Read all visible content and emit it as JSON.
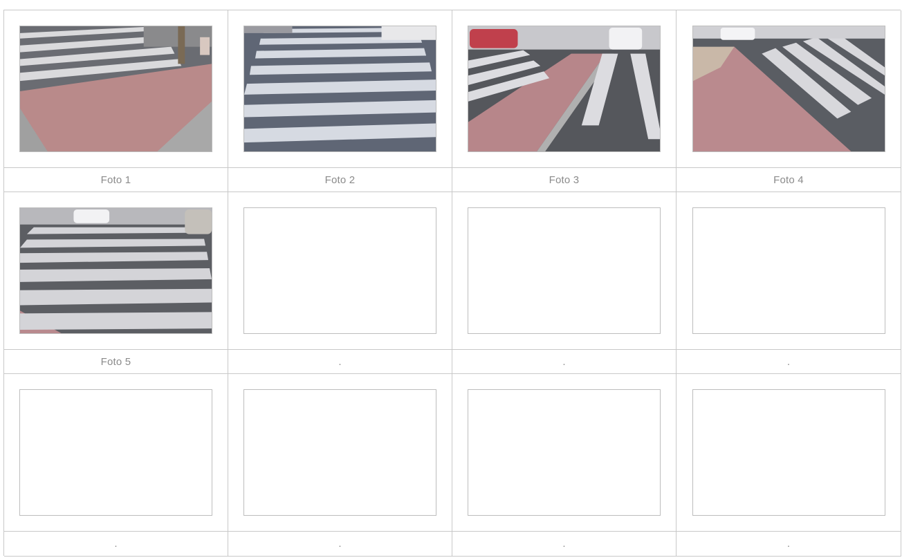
{
  "rows": [
    {
      "photos": [
        {
          "kind": "crosswalk-sidewalk-corner",
          "alt": "crosswalk-sidewalk-corner"
        },
        {
          "kind": "crosswalk-closeup",
          "alt": "crosswalk-closeup"
        },
        {
          "kind": "crosswalk-with-curb",
          "alt": "crosswalk-with-curb"
        },
        {
          "kind": "crosswalk-diagonal",
          "alt": "crosswalk-diagonal"
        }
      ],
      "captions": [
        "Foto 1",
        "Foto 2",
        "Foto 3",
        "Foto 4"
      ]
    },
    {
      "photos": [
        {
          "kind": "crosswalk-wide",
          "alt": "crosswalk-wide"
        },
        {
          "kind": "empty"
        },
        {
          "kind": "empty"
        },
        {
          "kind": "empty"
        }
      ],
      "captions": [
        "Foto 5",
        ".",
        ".",
        "."
      ]
    },
    {
      "photos": [
        {
          "kind": "empty"
        },
        {
          "kind": "empty"
        },
        {
          "kind": "empty"
        },
        {
          "kind": "empty"
        }
      ],
      "captions": [
        ".",
        ".",
        ".",
        "."
      ]
    }
  ],
  "colors": {
    "border": "#c8c8c8",
    "caption_text": "#8a8a8a",
    "asphalt": "#5e6168",
    "stripe": "#e4e4e6",
    "tile_red": "#b4787a"
  }
}
